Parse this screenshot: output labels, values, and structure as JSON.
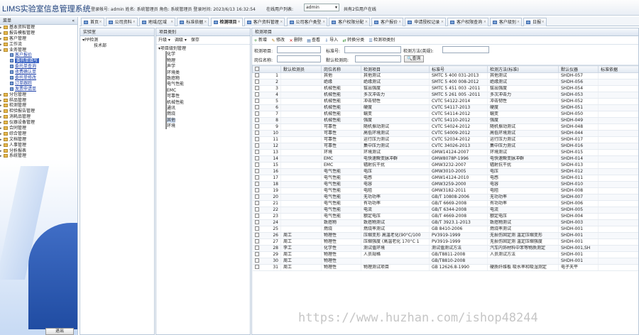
{
  "header": {
    "title": "LIMS实验室信息管理系统",
    "info": "登录帐号: admin  姓名: 系统管理员  角色: 系统管理员  登录时间: 2023/6/13 16:32:54",
    "online_label": "在线用户列表:",
    "online_selected": "admin",
    "online_count": "共有2位用户在线"
  },
  "leftnav": {
    "header": "菜单",
    "items": [
      {
        "label": "基本资料管理",
        "sub": false
      },
      {
        "label": "报告模板管理",
        "sub": false
      },
      {
        "label": "客户管理",
        "sub": false
      },
      {
        "label": "工作流",
        "sub": false
      },
      {
        "label": "业务管理",
        "sub": false
      },
      {
        "label": "客户报价",
        "sub": true
      },
      {
        "label": "委托单填写",
        "sub": true,
        "selected": true
      },
      {
        "label": "委托单查询",
        "sub": true
      },
      {
        "label": "收费确认单",
        "sub": true
      },
      {
        "label": "委托单修改",
        "sub": true
      },
      {
        "label": "订单跟踪",
        "sub": true
      },
      {
        "label": "发票申请单",
        "sub": true
      },
      {
        "label": "分包管理",
        "sub": false
      },
      {
        "label": "样品管理",
        "sub": false
      },
      {
        "label": "检测管理",
        "sub": false
      },
      {
        "label": "检验报告管理",
        "sub": false
      },
      {
        "label": "消耗品管理",
        "sub": false
      },
      {
        "label": "仪器设备管理",
        "sub": false
      },
      {
        "label": "合同管理",
        "sub": false
      },
      {
        "label": "综合管理",
        "sub": false
      },
      {
        "label": "文档管理",
        "sub": false
      },
      {
        "label": "人事管理",
        "sub": false
      },
      {
        "label": "分析报表",
        "sub": false
      },
      {
        "label": "系统管理",
        "sub": false
      }
    ],
    "logout": "退出"
  },
  "tabs": [
    {
      "label": "首页",
      "active": false
    },
    {
      "label": "公司资料",
      "active": false
    },
    {
      "label": "地域/区域",
      "active": false
    },
    {
      "label": "标准依据",
      "active": false
    },
    {
      "label": "检测项目",
      "active": true
    },
    {
      "label": "客户资料管理",
      "active": false
    },
    {
      "label": "公司客户类型",
      "active": false
    },
    {
      "label": "客户权限分配",
      "active": false
    },
    {
      "label": "客户报价",
      "active": false
    },
    {
      "label": "申请授权记录",
      "active": false
    },
    {
      "label": "客户权限查询",
      "active": false
    },
    {
      "label": "客户级别",
      "active": false
    },
    {
      "label": "日报",
      "active": false
    }
  ],
  "panel_lab": {
    "title": "实验室",
    "root": "PP检测",
    "child": "技术部"
  },
  "panel_cat": {
    "title": "项目类别",
    "toolbar": [
      "升级 ▾",
      "调级 ▾",
      "保存"
    ],
    "root": "项目级别管理",
    "children": [
      "化学",
      "物理",
      "声学",
      "环境类",
      "致癌物",
      "电气性能",
      "EMC",
      "可靠性",
      "机械性能",
      "通讯",
      "燃烧",
      "其他",
      "环境"
    ],
    "selected": "其他"
  },
  "panel_items": {
    "title": "检测项目",
    "toolbar": [
      "新增",
      "修改",
      "删除",
      "查看",
      "导入",
      "转换分类",
      "检测项类别"
    ],
    "search": {
      "item_label": "检测项目:",
      "std_label": "标准号:",
      "method_label": "检测方法(英规):",
      "position_label": "岗位名称:",
      "default_label": "默认检测岗:",
      "query_btn": "查询"
    },
    "columns": [
      "",
      "",
      "默认检测员",
      "岗位名称",
      "检测项目",
      "标准号",
      "检测方法(标准)",
      "默认仪器",
      "标准依据"
    ],
    "rows": [
      [
        "1",
        "",
        "其他",
        "其他测试",
        "SMTC 5 400 031-2013",
        "其他测试",
        "SHDH-057"
      ],
      [
        "2",
        "",
        "绝缘",
        "绝缘测试",
        "SMTC 5 400 008-2012",
        "绝缘测试",
        "SHDH-056"
      ],
      [
        "3",
        "",
        "机械性能",
        "拔出强度",
        "SMTC 5 451 003 -2011",
        "拔出强度",
        "SHDH-054"
      ],
      [
        "4",
        "",
        "机械性能",
        "多次冲击力",
        "SMTC 5 261 005 -2011",
        "多次冲击力",
        "SHDH-053"
      ],
      [
        "5",
        "",
        "机械性能",
        "冲击韧性",
        "CVTC 54122-2014",
        "冲击韧性",
        "SHDH-052"
      ],
      [
        "6",
        "",
        "机械性能",
        "硬度",
        "CVTC 54117-2013",
        "硬度",
        "SHDH-051"
      ],
      [
        "7",
        "",
        "机械性能",
        "蠕变",
        "CVTC 54114-2012",
        "蠕变",
        "SHDH-050"
      ],
      [
        "8",
        "",
        "机械性能",
        "强度",
        "CVTC 54110-2012",
        "强度",
        "SHDH-049"
      ],
      [
        "9",
        "",
        "可靠性",
        "随机振动测试",
        "CVTC 54024-2012",
        "随机振动测试",
        "SHDH-048"
      ],
      [
        "10",
        "",
        "可靠性",
        "高低环境测试",
        "CVTC 54009-2012",
        "高低环境测试",
        "SHDH-044"
      ],
      [
        "11",
        "",
        "可靠性",
        "运行压力测试",
        "CVTC 52034-2012",
        "运行压力测试",
        "SHDH-017"
      ],
      [
        "12",
        "",
        "可靠性",
        "集中压力测试",
        "CVTC 34026-2013",
        "集中压力测试",
        "SHDH-016"
      ],
      [
        "13",
        "",
        "环境",
        "环境测试",
        "GMW14124-2007",
        "环境测试",
        "SHDH-015"
      ],
      [
        "14",
        "",
        "EMC",
        "电快速瞬变脉冲群",
        "GMW8078P-1996",
        "电快速瞬变脉冲群",
        "SHDH-014"
      ],
      [
        "15",
        "",
        "EMC",
        "辐射抗干扰",
        "GMW3232-2007",
        "辐射抗干扰",
        "SHDH-013"
      ],
      [
        "16",
        "",
        "电气性能",
        "电压",
        "GMW3010-2005",
        "电压",
        "SHDH-012"
      ],
      [
        "17",
        "",
        "电气性能",
        "电感",
        "GMW14124-2010",
        "电感",
        "SHDH-011"
      ],
      [
        "18",
        "",
        "电气性能",
        "电容",
        "GMW3259-2000",
        "电容",
        "SHDH-010"
      ],
      [
        "19",
        "",
        "电气性能",
        "电阻",
        "GMW3182-2011",
        "电阻",
        "SHDH-008"
      ],
      [
        "20",
        "",
        "电气性能",
        "无功功率",
        "GB/T 10808-2006",
        "无功功率",
        "SHDH-007"
      ],
      [
        "21",
        "",
        "电气性能",
        "有功功率",
        "GB/T 6669-2008",
        "有功功率",
        "SHDH-006"
      ],
      [
        "22",
        "",
        "电气性能",
        "电流",
        "GB/T 6344-2008",
        "电流",
        "SHDH-005"
      ],
      [
        "23",
        "",
        "电气性能",
        "额定电压",
        "GB/T 4669-2008",
        "额定电压",
        "SHDH-004"
      ],
      [
        "24",
        "",
        "致癌物",
        "致癌物测试",
        "GB/T 3923.1-2013",
        "致癌物测试",
        "SHDH-003"
      ],
      [
        "25",
        "",
        "燃烧",
        "燃烧率测试",
        "GB 8410-2006",
        "燃烧率测试",
        "SHDH-001"
      ],
      [
        "26",
        "周工",
        "物理性",
        "压缩变形 高温老化(90°C/100",
        "PV3919-1999",
        "无损伤固定测 温定压缩变形",
        "SHDH-001"
      ],
      [
        "27",
        "周工",
        "物理性",
        "压缩强度 (高温老化 170°C 1",
        "PV3919-1999",
        "无损伤固定测 温定压缩强度",
        "SHDH-001"
      ],
      [
        "28",
        "李工",
        "化学性",
        "测试值环境",
        "测试值测试方法",
        "汽车内饰材料中苯等物质测定",
        "SHDH-001,SH"
      ],
      [
        "29",
        "周工",
        "物理性",
        "人员规格",
        "GB/T8811-2008",
        "人员测试方法",
        "SHDH-001"
      ],
      [
        "30",
        "周工",
        "物理性",
        "",
        "GB/T8810-2008",
        "",
        "SHDH-001"
      ],
      [
        "31",
        "周工",
        "物理性",
        "物理测试项目",
        "GB 12626.8-1990",
        "硬质纤维板 吸水率和吸湿测定",
        "电子天平"
      ]
    ]
  },
  "watermark": "https://www.huzhan.com/ishop48244"
}
